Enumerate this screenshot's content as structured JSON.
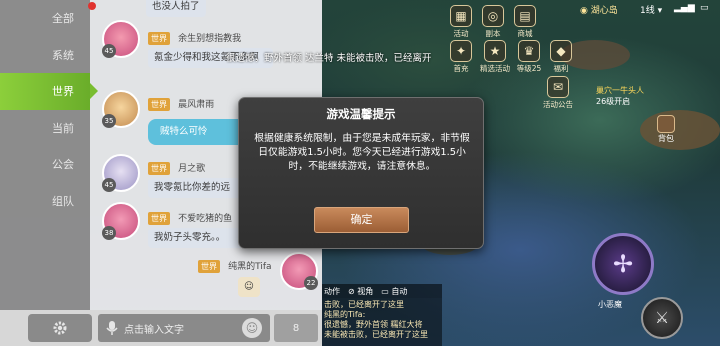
{
  "chat": {
    "tabs": [
      "全部",
      "系统",
      "世界",
      "当前",
      "公会",
      "组队"
    ],
    "messages": [
      {
        "channel": "世界",
        "name": "",
        "text": "也没人拍了",
        "level": ""
      },
      {
        "channel": "世界",
        "name": "余生别想指教我",
        "text": "氪金少得和我这氪不多啊",
        "level": "45"
      },
      {
        "channel": "世界",
        "name": "晨风肃雨",
        "text": "贼特么可怜",
        "level": "35"
      },
      {
        "channel": "世界",
        "name": "月之歌",
        "text": "我零氪比你差的远",
        "level": "45"
      },
      {
        "channel": "世界",
        "name": "不爱吃猪的鱼",
        "text": "我奶子头零充。。",
        "level": "38"
      },
      {
        "channel": "世界",
        "name": "纯黑的Tifa",
        "text": "",
        "level": "22"
      }
    ],
    "input_placeholder": "点击输入文字",
    "send_count": "8"
  },
  "hud": {
    "location": "湖心岛",
    "line": "1线",
    "icons_row1": [
      "活动",
      "副本",
      "商城"
    ],
    "icons_row2": [
      "首充",
      "精选活动",
      "等级25",
      "福利"
    ],
    "event_notice": "活动公告",
    "quest_title": "巢穴一牛头人",
    "quest_sub": "26级开启",
    "bag": "背包",
    "skill_label": "小恶魔"
  },
  "banner": "很遗憾，野外首领 达兰特 未能被击败，已经离开",
  "modal": {
    "title": "游戏温馨提示",
    "body": "根据健康系统限制，由于您是未成年玩家，非节假日仅能游戏1.5小时。您今天已经进行游戏1.5小时，不能继续游戏，请注意休息。",
    "confirm": "确定"
  },
  "bottom_chat": {
    "tabs": [
      "动作",
      "视角",
      "自动"
    ],
    "lines": [
      "击败，已经离开了这里",
      "纯黑的Tifa:",
      "很遗憾，野外首领 糯红大将",
      "未能被击败，已经离开了这里"
    ]
  }
}
